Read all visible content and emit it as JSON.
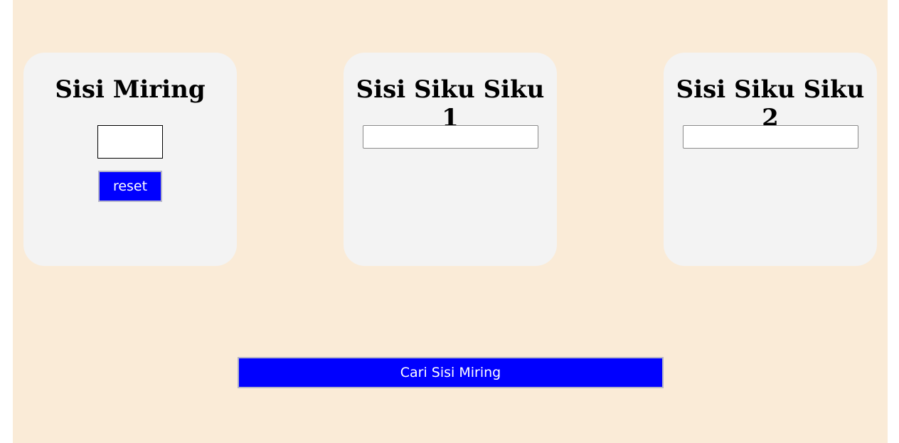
{
  "cards": [
    {
      "title": "Sisi Miring",
      "input_value": ""
    },
    {
      "title": "Sisi Siku Siku 1",
      "input_value": ""
    },
    {
      "title": "Sisi Siku Siku 2",
      "input_value": ""
    }
  ],
  "buttons": {
    "reset_label": "reset",
    "calculate_label": "Cari Sisi Miring"
  },
  "colors": {
    "page_background": "#faebd7",
    "card_background": "#f3f3f3",
    "button_background": "#0000ff",
    "button_text": "#ffffff"
  }
}
